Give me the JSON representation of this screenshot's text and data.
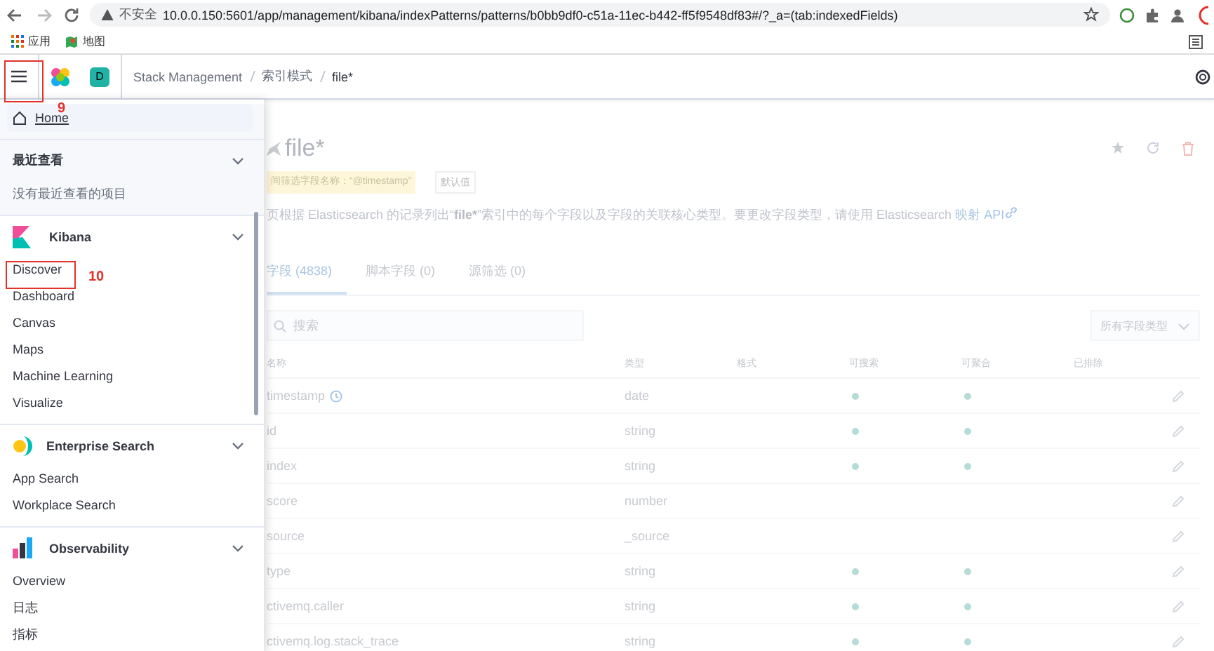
{
  "browser": {
    "security": "不安全",
    "url": "10.0.0.150:5601/app/management/kibana/indexPatterns/patterns/b0bb9df0-c51a-11ec-b442-ff5f9548df83#/?_a=(tab:indexedFields)",
    "bookmarks": [
      "应用",
      "地图"
    ]
  },
  "header": {
    "space": "D",
    "breadcrumbs": [
      "Stack Management",
      "索引模式",
      "file*"
    ]
  },
  "nav": {
    "home": "Home",
    "sections": [
      {
        "kind": "recent",
        "title": "最近查看",
        "expanded": true,
        "empty": "没有最近查看的项目"
      },
      {
        "kind": "kibana",
        "title": "Kibana",
        "expanded": true,
        "items": [
          "Discover",
          "Dashboard",
          "Canvas",
          "Maps",
          "Machine Learning",
          "Visualize"
        ]
      },
      {
        "kind": "enterprise",
        "title": "Enterprise Search",
        "expanded": true,
        "items": [
          "App Search",
          "Workplace Search"
        ]
      },
      {
        "kind": "observability",
        "title": "Observability",
        "expanded": true,
        "items": [
          "Overview",
          "日志",
          "指标"
        ]
      }
    ]
  },
  "page": {
    "title": "file*",
    "badges": [
      "间筛选字段名称：“@timestamp”",
      "默认值"
    ],
    "description": {
      "before": "页根据 Elasticsearch 的记录列出“",
      "bold": "file*",
      "after": "”索引中的每个字段以及字段的关联核心类型。要更改字段类型，请使用 Elasticsearch ",
      "link": "映射 API"
    },
    "tabs": [
      {
        "label": "字段 (4838)",
        "selected": true
      },
      {
        "label": "脚本字段 (0)",
        "selected": false
      },
      {
        "label": "源筛选 (0)",
        "selected": false
      }
    ],
    "search": {
      "placeholder": "搜索"
    },
    "type_filter": "所有字段类型",
    "columns": [
      "名称",
      "类型",
      "格式",
      "可搜索",
      "可聚合",
      "已排除"
    ],
    "rows": [
      {
        "name": "timestamp",
        "time_field": true,
        "type": "date",
        "searchable": true,
        "aggregatable": true
      },
      {
        "name": "id",
        "time_field": false,
        "type": "string",
        "searchable": true,
        "aggregatable": true
      },
      {
        "name": "index",
        "time_field": false,
        "type": "string",
        "searchable": true,
        "aggregatable": true
      },
      {
        "name": "score",
        "time_field": false,
        "type": "number",
        "searchable": false,
        "aggregatable": false
      },
      {
        "name": "source",
        "time_field": false,
        "type": "_source",
        "searchable": false,
        "aggregatable": false
      },
      {
        "name": "type",
        "time_field": false,
        "type": "string",
        "searchable": true,
        "aggregatable": true
      },
      {
        "name": "ctivemq.caller",
        "time_field": false,
        "type": "string",
        "searchable": true,
        "aggregatable": true
      },
      {
        "name": "ctivemq.log.stack_trace",
        "time_field": false,
        "type": "string",
        "searchable": true,
        "aggregatable": true
      }
    ]
  },
  "annotations": [
    {
      "label": "9"
    },
    {
      "label": "10"
    }
  ]
}
